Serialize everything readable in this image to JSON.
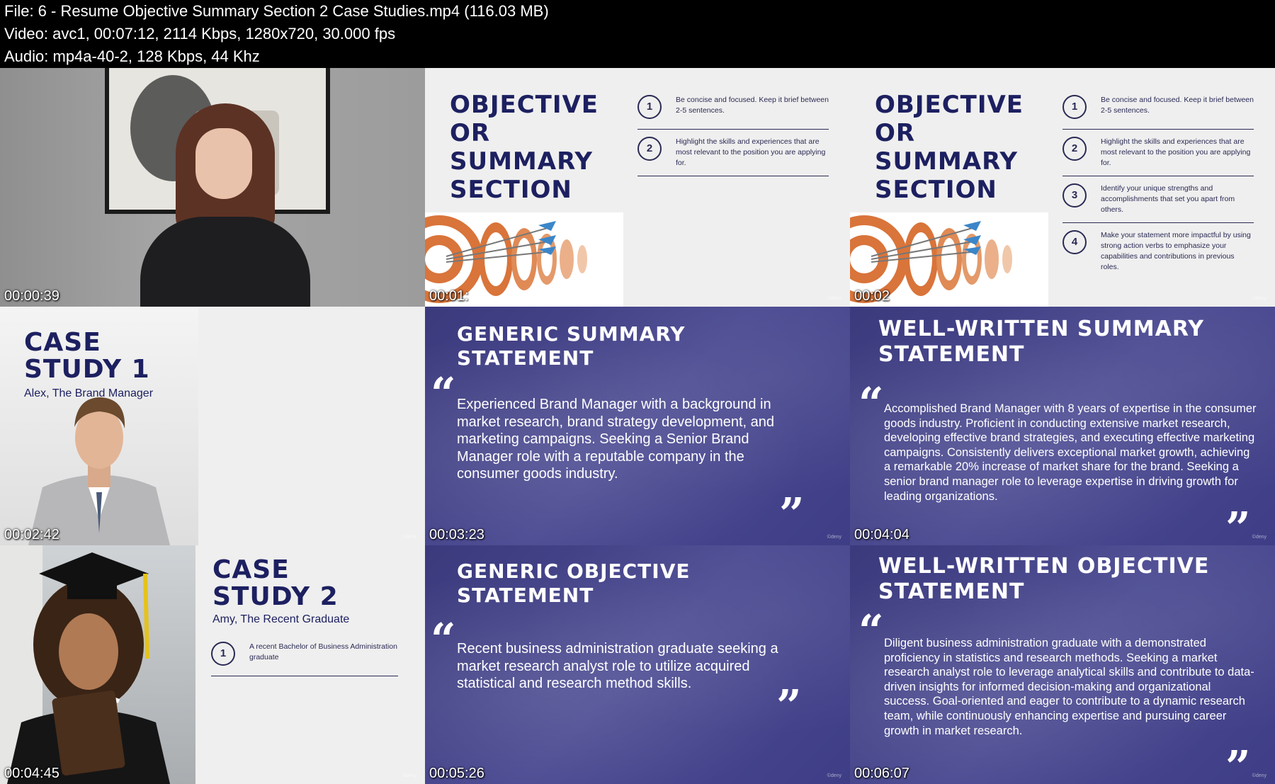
{
  "header": {
    "file_line": "File: 6 - Resume Objective Summary Section 2 Case Studies.mp4 (116.03 MB)",
    "video_line": "Video: avc1, 00:07:12, 2114 Kbps, 1280x720, 30.000 fps",
    "audio_line": "Audio: mp4a-40-2, 128 Kbps, 44 Khz"
  },
  "watermark": "©deny",
  "tiles": {
    "t1": {
      "timestamp": "00:00:39"
    },
    "t2": {
      "timestamp": "00:01:",
      "title": [
        "OBJECTIVE",
        "OR",
        "SUMMARY",
        "SECTION"
      ],
      "items": [
        {
          "num": "1",
          "text": "Be concise and focused. Keep it brief between 2-5 sentences."
        },
        {
          "num": "2",
          "text": "Highlight the skills and experiences that are most relevant to the position you are applying for."
        }
      ]
    },
    "t3": {
      "timestamp": "00:02",
      "title": [
        "OBJECTIVE",
        "OR",
        "SUMMARY",
        "SECTION"
      ],
      "items": [
        {
          "num": "1",
          "text": "Be concise and focused. Keep it brief between 2-5 sentences."
        },
        {
          "num": "2",
          "text": "Highlight the skills and experiences that are most relevant to the position you are applying for."
        },
        {
          "num": "3",
          "text": "Identify your unique strengths and accomplishments that set you apart from others."
        },
        {
          "num": "4",
          "text": "Make your statement more impactful by using strong action verbs to emphasize your capabilities and contributions in previous roles."
        }
      ]
    },
    "t4": {
      "timestamp": "00:02:42",
      "title_line1": "CASE",
      "title_line2": "STUDY 1",
      "subtitle": "Alex, The Brand Manager"
    },
    "t5": {
      "timestamp": "00:03:23",
      "title_line1": "GENERIC SUMMARY",
      "title_line2": "STATEMENT",
      "quote_open": "“",
      "quote_close": "”",
      "text": "Experienced Brand Manager with a background in market research, brand strategy development, and marketing campaigns. Seeking a Senior Brand Manager role with a reputable company in the consumer goods industry."
    },
    "t6": {
      "timestamp": "00:04:04",
      "title_line1": "WELL-WRITTEN SUMMARY",
      "title_line2": "STATEMENT",
      "quote_open": "“",
      "quote_close": "”",
      "text": "Accomplished Brand Manager with 8 years of expertise in the consumer goods industry. Proficient in conducting extensive market research, developing effective brand strategies, and executing effective marketing campaigns. Consistently delivers exceptional market growth, achieving a remarkable 20% increase of market share for the brand. Seeking a senior brand manager role to leverage expertise in driving growth for leading organizations."
    },
    "t7": {
      "timestamp": "00:04:45",
      "title_line1": "CASE",
      "title_line2": "STUDY 2",
      "subtitle": "Amy, The Recent Graduate",
      "item_num": "1",
      "item_text": "A recent Bachelor of Business Administration graduate"
    },
    "t8": {
      "timestamp": "00:05:26",
      "title_line1": "GENERIC OBJECTIVE",
      "title_line2": "STATEMENT",
      "quote_open": "“",
      "quote_close": "”",
      "text": "Recent business administration graduate seeking a market research analyst role to utilize acquired statistical and research method skills."
    },
    "t9": {
      "timestamp": "00:06:07",
      "title_line1": "WELL-WRITTEN OBJECTIVE",
      "title_line2": "STATEMENT",
      "quote_open": "“",
      "quote_close": "”",
      "text": "Diligent business administration graduate with a demonstrated proficiency in statistics and research methods. Seeking a market research analyst role to leverage analytical skills and contribute to data-driven insights for informed decision-making and organizational success. Goal-oriented and eager to contribute to a dynamic research team, while continuously enhancing expertise and pursuing career growth in market research."
    }
  }
}
